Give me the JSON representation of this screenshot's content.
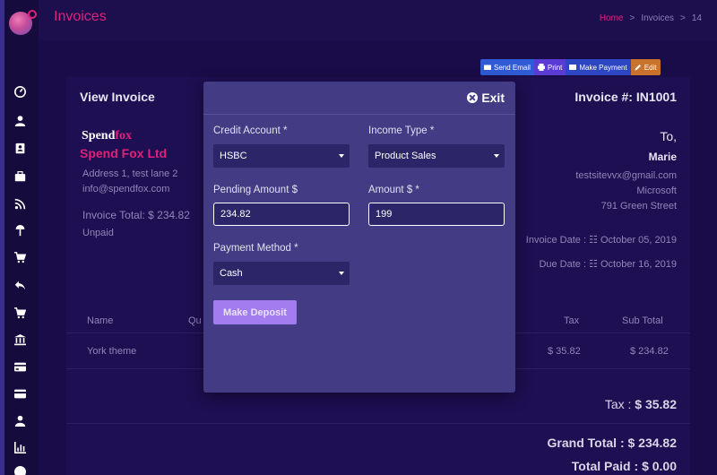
{
  "header": {
    "title": "Invoices",
    "breadcrumb": {
      "home": "Home",
      "sep": ">",
      "section": "Invoices",
      "current": "14"
    }
  },
  "sidebar": {
    "icons": [
      "dashboard-icon",
      "user-icon",
      "contact-card-icon",
      "briefcase-icon",
      "rss-icon",
      "paint-roller-icon",
      "cart-icon",
      "reply-icon",
      "cart-plus-icon",
      "bank-icon",
      "credit-card-icon",
      "card-icon",
      "users-icon",
      "bar-chart-icon",
      "help-icon"
    ]
  },
  "actions": {
    "send_email": "Send Email",
    "print": "Print",
    "make_payment": "Make Payment",
    "edit": "Edit"
  },
  "invoice": {
    "title": "View Invoice",
    "number": "Invoice #: IN1001",
    "logo_part1": "Spend",
    "logo_part2": "fox",
    "company": "Spend Fox Ltd",
    "address": "Address 1, test lane 2",
    "email": "info@spendfox.com",
    "total_label": "Invoice Total:  $ 234.82",
    "status": "Unpaid",
    "to_label": "To,",
    "client_name": "Marie",
    "client_email": "testsitevvx@gmail.com",
    "client_company": "Microsoft",
    "client_address": "791 Green Street",
    "invoice_date": "Invoice Date : ☷ October 05, 2019",
    "due_date": "Due Date : ☷ October 16, 2019",
    "table": {
      "col_name": "Name",
      "col_qty": "Qu",
      "col_tax": "Tax",
      "col_subtotal": "Sub Total",
      "row_name": "York theme",
      "row_tax": "$ 35.82",
      "row_subtotal": "$ 234.82"
    },
    "tax_label": "Tax :",
    "tax_value": "$ 35.82",
    "grand_total_label": "Grand Total :",
    "grand_total_value": "$ 234.82",
    "total_paid_label": "Total Paid :",
    "total_paid_value": "$ 0.00"
  },
  "modal": {
    "exit_label": "Exit",
    "credit_account_label": "Credit Account *",
    "credit_account_value": "HSBC",
    "income_type_label": "Income Type *",
    "income_type_value": "Product Sales",
    "pending_amount_label": "Pending Amount $",
    "pending_amount_value": "234.82",
    "amount_label": "Amount $ *",
    "amount_value": "199",
    "payment_method_label": "Payment Method *",
    "payment_method_value": "Cash",
    "deposit_button": "Make Deposit"
  },
  "colors": {
    "accent": "#e0217a",
    "modal_bg": "#433b84",
    "deposit": "#a37cf0"
  }
}
